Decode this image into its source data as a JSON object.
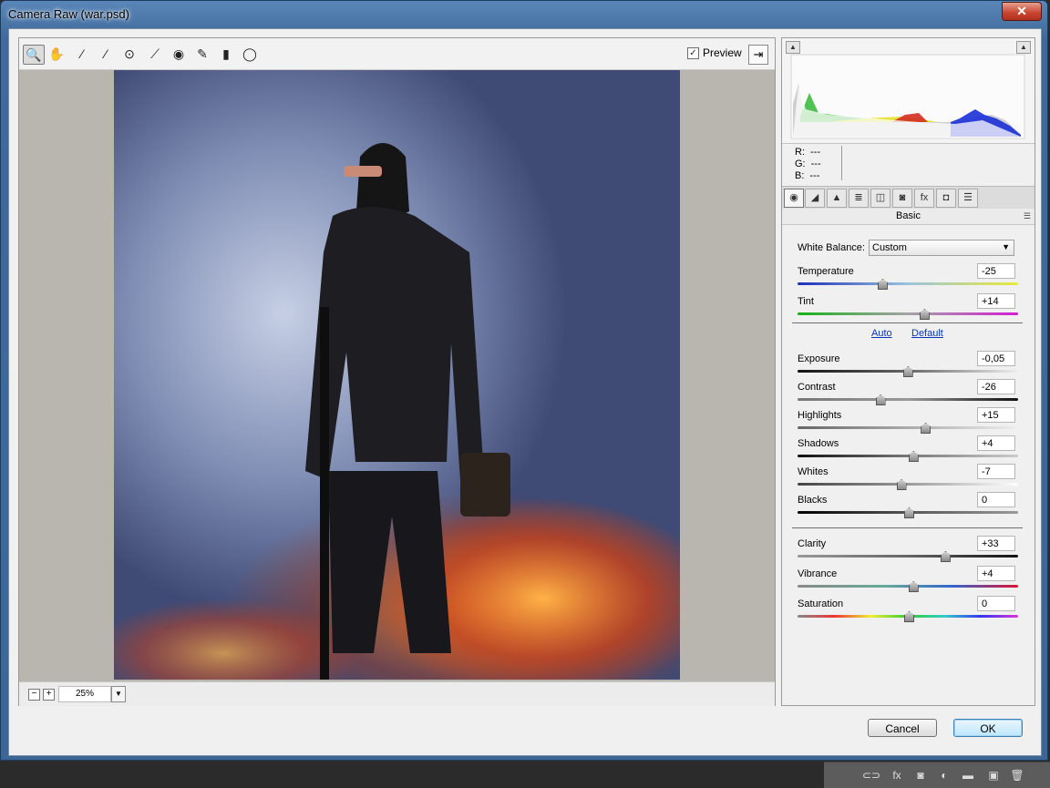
{
  "window": {
    "title": "Camera Raw (war.psd)",
    "close_label": "✕"
  },
  "toolbar": {
    "tools": [
      {
        "name": "zoom-tool",
        "icon": "magnifier-icon",
        "glyph": "🔍"
      },
      {
        "name": "hand-tool",
        "icon": "hand-icon",
        "glyph": "✋"
      },
      {
        "name": "white-balance-tool",
        "icon": "eyedropper-icon",
        "glyph": "⁄"
      },
      {
        "name": "color-sampler-tool",
        "icon": "color-sampler-icon",
        "glyph": "⁄"
      },
      {
        "name": "targeted-adjustment-tool",
        "icon": "target-icon",
        "glyph": "⊙"
      },
      {
        "name": "straighten-tool",
        "icon": "straighten-icon",
        "glyph": "⟋"
      },
      {
        "name": "red-eye-tool",
        "icon": "eye-icon",
        "glyph": "◉"
      },
      {
        "name": "adjustment-brush-tool",
        "icon": "brush-icon",
        "glyph": "✎"
      },
      {
        "name": "graduated-filter-tool",
        "icon": "graduated-filter-icon",
        "glyph": "▮"
      },
      {
        "name": "radial-filter-tool",
        "icon": "radial-filter-icon",
        "glyph": "◯"
      }
    ],
    "preview_label": "Preview",
    "preview_checked": "✓",
    "fullscreen_glyph": "⇥"
  },
  "status": {
    "zoom_minus": "−",
    "zoom_plus": "+",
    "zoom_value": "25%",
    "zoom_arrow": "▼"
  },
  "readout": {
    "r_label": "R:",
    "r_value": "---",
    "g_label": "G:",
    "g_value": "---",
    "b_label": "B:",
    "b_value": "---"
  },
  "tabs": [
    {
      "name": "tab-basic",
      "glyph": "◉"
    },
    {
      "name": "tab-tone-curve",
      "glyph": "◢"
    },
    {
      "name": "tab-detail",
      "glyph": "▲"
    },
    {
      "name": "tab-hsl",
      "glyph": "≣"
    },
    {
      "name": "tab-split-toning",
      "glyph": "◫"
    },
    {
      "name": "tab-lens-corrections",
      "glyph": "◙"
    },
    {
      "name": "tab-effects",
      "glyph": "fx"
    },
    {
      "name": "tab-camera-calibration",
      "glyph": "◘"
    },
    {
      "name": "tab-presets",
      "glyph": "☰"
    }
  ],
  "panel": {
    "section_title": "Basic",
    "menu_glyph": "☰",
    "white_balance_label": "White Balance:",
    "white_balance_value": "Custom",
    "auto_label": "Auto",
    "default_label": "Default",
    "controls": [
      {
        "name": "temperature",
        "label": "Temperature",
        "value": "-25",
        "position": 0.38
      },
      {
        "name": "tint",
        "label": "Tint",
        "value": "+14",
        "position": 0.57
      },
      {
        "name": "exposure",
        "label": "Exposure",
        "value": "-0,05",
        "position": 0.495
      },
      {
        "name": "contrast",
        "label": "Contrast",
        "value": "-26",
        "position": 0.37
      },
      {
        "name": "highlights",
        "label": "Highlights",
        "value": "+15",
        "position": 0.575
      },
      {
        "name": "shadows",
        "label": "Shadows",
        "value": "+4",
        "position": 0.52
      },
      {
        "name": "whites",
        "label": "Whites",
        "value": "-7",
        "position": 0.465
      },
      {
        "name": "blacks",
        "label": "Blacks",
        "value": "0",
        "position": 0.5
      },
      {
        "name": "clarity",
        "label": "Clarity",
        "value": "+33",
        "position": 0.665
      },
      {
        "name": "vibrance",
        "label": "Vibrance",
        "value": "+4",
        "position": 0.52
      },
      {
        "name": "saturation",
        "label": "Saturation",
        "value": "0",
        "position": 0.5
      }
    ]
  },
  "buttons": {
    "cancel": "Cancel",
    "ok": "OK"
  },
  "ps_icons": [
    {
      "name": "link-layers-icon",
      "glyph": "⊂⊃"
    },
    {
      "name": "layer-style-icon",
      "glyph": "fx"
    },
    {
      "name": "layer-mask-icon",
      "glyph": "◙"
    },
    {
      "name": "adjustment-layer-icon",
      "glyph": "◐"
    },
    {
      "name": "new-group-icon",
      "glyph": "▬"
    },
    {
      "name": "new-layer-icon",
      "glyph": "▣"
    },
    {
      "name": "delete-layer-icon",
      "glyph": "🗑"
    }
  ]
}
